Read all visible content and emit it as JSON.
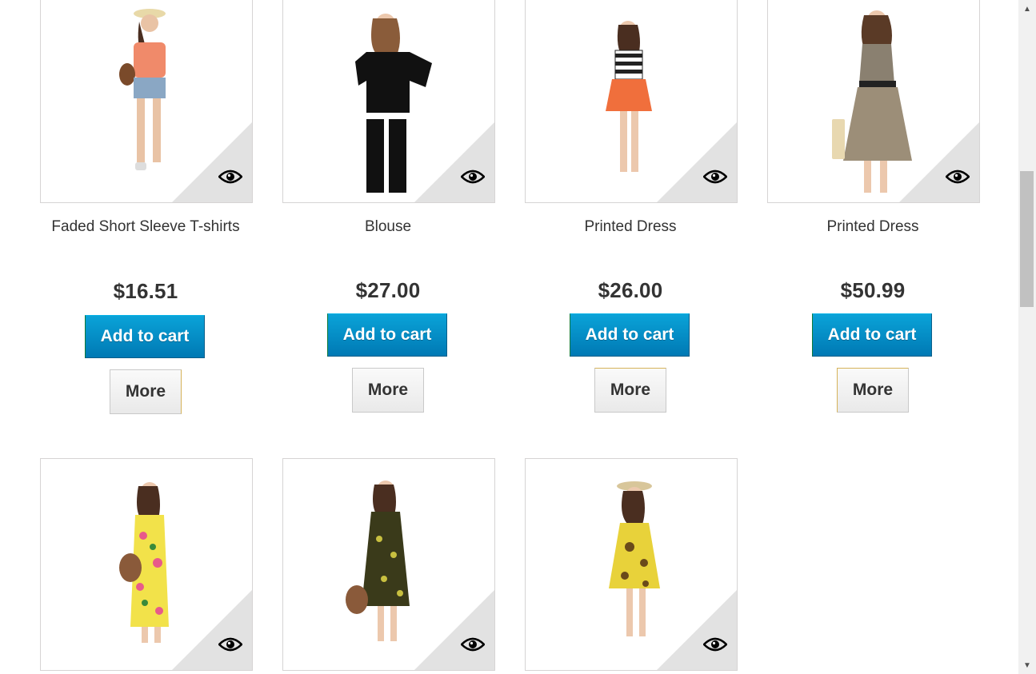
{
  "products": [
    {
      "name": "Faded Short Sleeve T-shirts",
      "price": "$16.51",
      "add_to_cart_label": "Add to cart",
      "more_label": "More",
      "quick_view_icon": "eye-icon"
    },
    {
      "name": "Blouse",
      "price": "$27.00",
      "add_to_cart_label": "Add to cart",
      "more_label": "More",
      "quick_view_icon": "eye-icon"
    },
    {
      "name": "Printed Dress",
      "price": "$26.00",
      "add_to_cart_label": "Add to cart",
      "more_label": "More",
      "quick_view_icon": "eye-icon"
    },
    {
      "name": "Printed Dress",
      "price": "$50.99",
      "add_to_cart_label": "Add to cart",
      "more_label": "More",
      "quick_view_icon": "eye-icon"
    },
    {
      "quick_view_icon": "eye-icon"
    },
    {
      "quick_view_icon": "eye-icon"
    },
    {
      "quick_view_icon": "eye-icon"
    }
  ],
  "colors": {
    "cart_button": "#0079b4",
    "text": "#333333",
    "border": "#d6d4d4"
  },
  "scrollbar": {
    "up_icon": "scroll-up-arrow-icon",
    "down_icon": "scroll-down-arrow-icon"
  }
}
